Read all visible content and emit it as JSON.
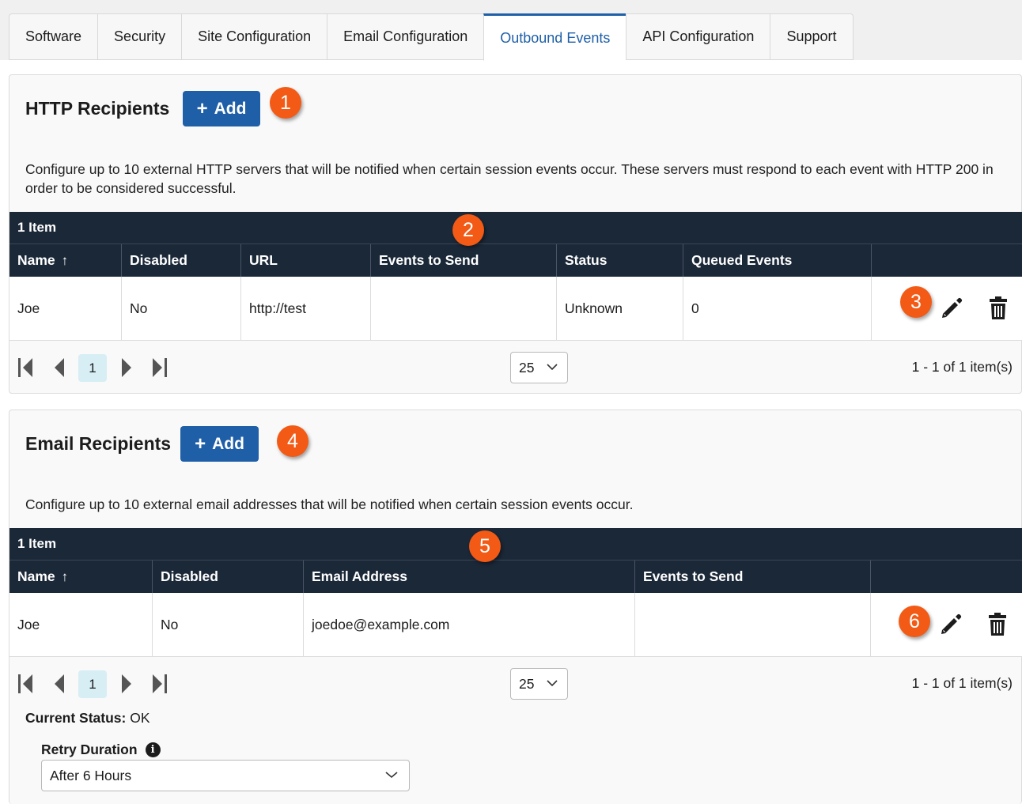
{
  "tabs": [
    {
      "label": "Software"
    },
    {
      "label": "Security"
    },
    {
      "label": "Site Configuration"
    },
    {
      "label": "Email Configuration"
    },
    {
      "label": "Outbound Events",
      "active": true
    },
    {
      "label": "API Configuration"
    },
    {
      "label": "Support"
    }
  ],
  "http": {
    "title": "HTTP Recipients",
    "add_label": "Add",
    "description": "Configure up to 10 external HTTP servers that will be notified when certain session events occur. These servers must respond to each event with HTTP 200 in order to be considered successful.",
    "item_count": "1 Item",
    "columns": [
      "Name",
      "Disabled",
      "URL",
      "Events to Send",
      "Status",
      "Queued Events",
      ""
    ],
    "rows": [
      {
        "name": "Joe",
        "disabled": "No",
        "url": "http://test",
        "events": "",
        "status": "Unknown",
        "queued": "0"
      }
    ],
    "pager": {
      "page": "1",
      "page_size": "25",
      "info": "1 - 1 of 1 item(s)"
    }
  },
  "email": {
    "title": "Email Recipients",
    "add_label": "Add",
    "description": "Configure up to 10 external email addresses that will be notified when certain session events occur.",
    "item_count": "1 Item",
    "columns": [
      "Name",
      "Disabled",
      "Email Address",
      "Events to Send",
      ""
    ],
    "rows": [
      {
        "name": "Joe",
        "disabled": "No",
        "email": "joedoe@example.com",
        "events": ""
      }
    ],
    "pager": {
      "page": "1",
      "page_size": "25",
      "info": "1 - 1 of 1 item(s)"
    }
  },
  "callouts": [
    "1",
    "2",
    "3",
    "4",
    "5",
    "6"
  ],
  "status": {
    "label": "Current Status:",
    "value": "OK"
  },
  "retry": {
    "label": "Retry Duration",
    "value": "After 6 Hours"
  },
  "colors": {
    "accent": "#1e5fa8",
    "header_bg": "#1b2838",
    "callout": "#f25a16",
    "page_highlight": "#d6eef4"
  }
}
